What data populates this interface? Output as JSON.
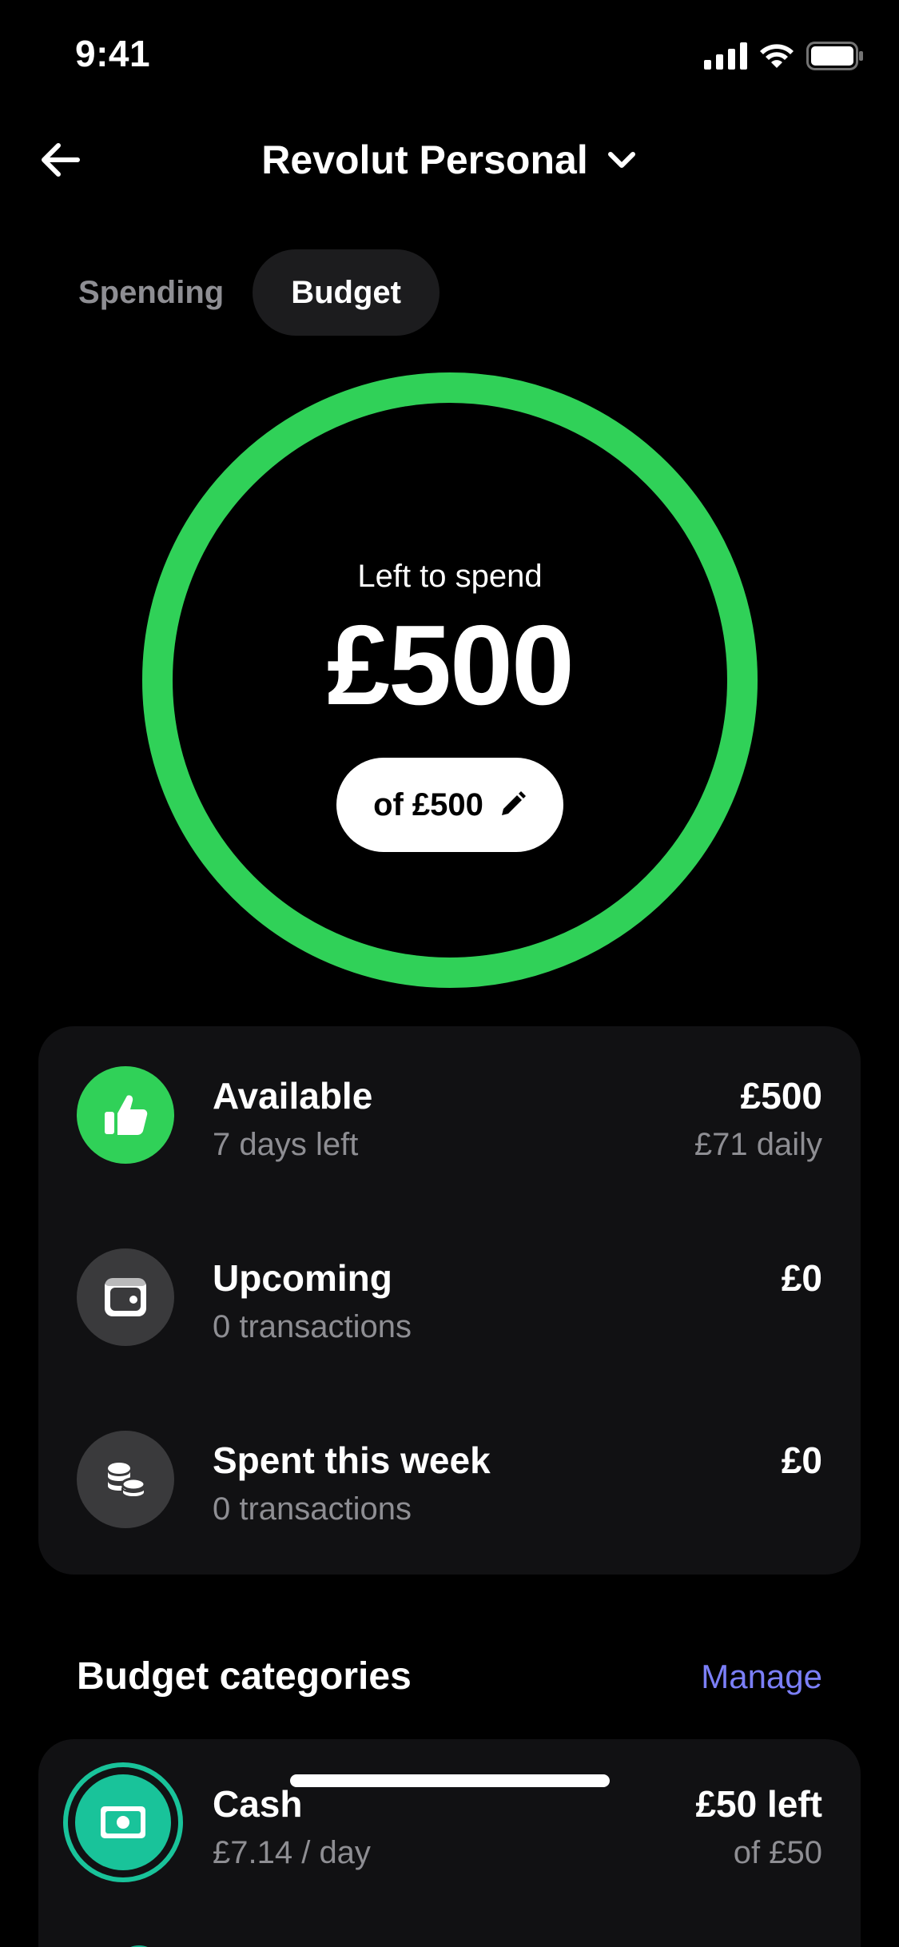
{
  "status_bar": {
    "time": "9:41"
  },
  "nav": {
    "account_title": "Revolut Personal"
  },
  "tabs": [
    {
      "label": "Spending",
      "active": false
    },
    {
      "label": "Budget",
      "active": true
    }
  ],
  "budget_ring": {
    "label": "Left to spend",
    "amount": "£500",
    "total_pill": "of £500",
    "fraction_remaining": 1.0,
    "color": "#30d158"
  },
  "summary": {
    "available": {
      "title": "Available",
      "subtitle": "7 days left",
      "value": "£500",
      "value_sub": "£71 daily",
      "icon": "thumbs-up-icon",
      "icon_bg": "#30d158"
    },
    "upcoming": {
      "title": "Upcoming",
      "subtitle": "0 transactions",
      "value": "£0",
      "icon": "wallet-icon",
      "icon_bg": "#3a3a3c"
    },
    "spent": {
      "title": "Spent this week",
      "subtitle": "0 transactions",
      "value": "£0",
      "icon": "coins-icon",
      "icon_bg": "#3a3a3c"
    }
  },
  "categories": {
    "title": "Budget categories",
    "manage_label": "Manage",
    "items": [
      {
        "name": "Cash",
        "subtitle": "£7.14 / day",
        "value": "£50 left",
        "value_sub": "of £50",
        "icon": "banknote-icon",
        "color": "#19c39a"
      }
    ]
  }
}
